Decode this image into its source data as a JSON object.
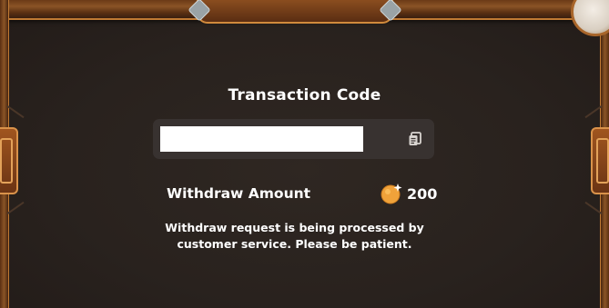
{
  "dialog": {
    "transaction_label": "Transaction Code",
    "transaction_code": "",
    "withdraw_label": "Withdraw Amount",
    "withdraw_amount": "200",
    "note_line1": "Withdraw request is being processed by",
    "note_line2": "customer service. Please be patient."
  },
  "icons": {
    "copy": "copy-icon",
    "coin": "coin-icon"
  },
  "colors": {
    "background": "#2a231f",
    "field_box": "#383230",
    "frame_wood": "#8a5426",
    "frame_trim": "#c07a33",
    "coin": "#f0a23a",
    "text": "#ffffff"
  }
}
